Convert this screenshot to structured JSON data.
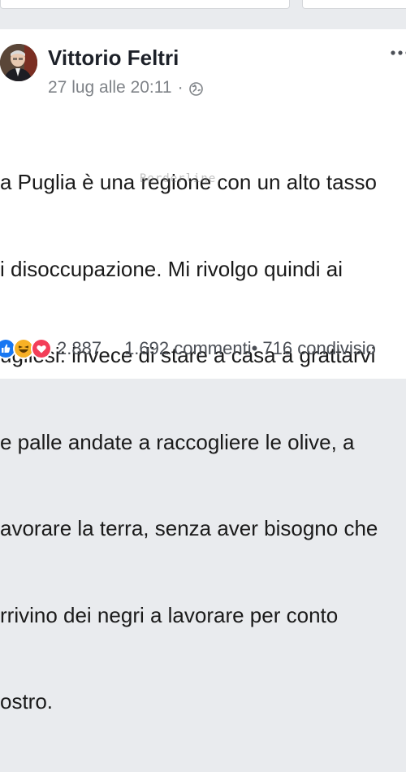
{
  "post": {
    "author": "Vittorio Feltri",
    "timestamp": "27 lug alle 20:11",
    "separator": "·",
    "privacy_icon": "globe-icon",
    "more_icon": "ellipsis-icon",
    "body_lines": [
      "a Puglia è una regione con un alto tasso",
      "i disoccupazione. Mi rivolgo quindi ai",
      "ugliesi: invece di stare a casa a grattarvi",
      "e palle andate a raccogliere le olive, a",
      "avorare la terra, senza aver bisogno che",
      "rrivino dei negri a lavorare per conto",
      "ostro."
    ],
    "watermark": "Borderline"
  },
  "footer": {
    "reaction_icons": [
      "like-icon",
      "haha-icon",
      "love-icon"
    ],
    "reaction_count": "2.887",
    "comments": "1.692 commenti",
    "shares": " • 716 condivisio"
  },
  "colors": {
    "page_bg": "#e9ebee",
    "card_bg": "#ffffff",
    "meta_gray": "#7f8388",
    "like_blue": "#1877f2",
    "haha_yellow": "#f7b125",
    "love_red": "#f33e58"
  }
}
